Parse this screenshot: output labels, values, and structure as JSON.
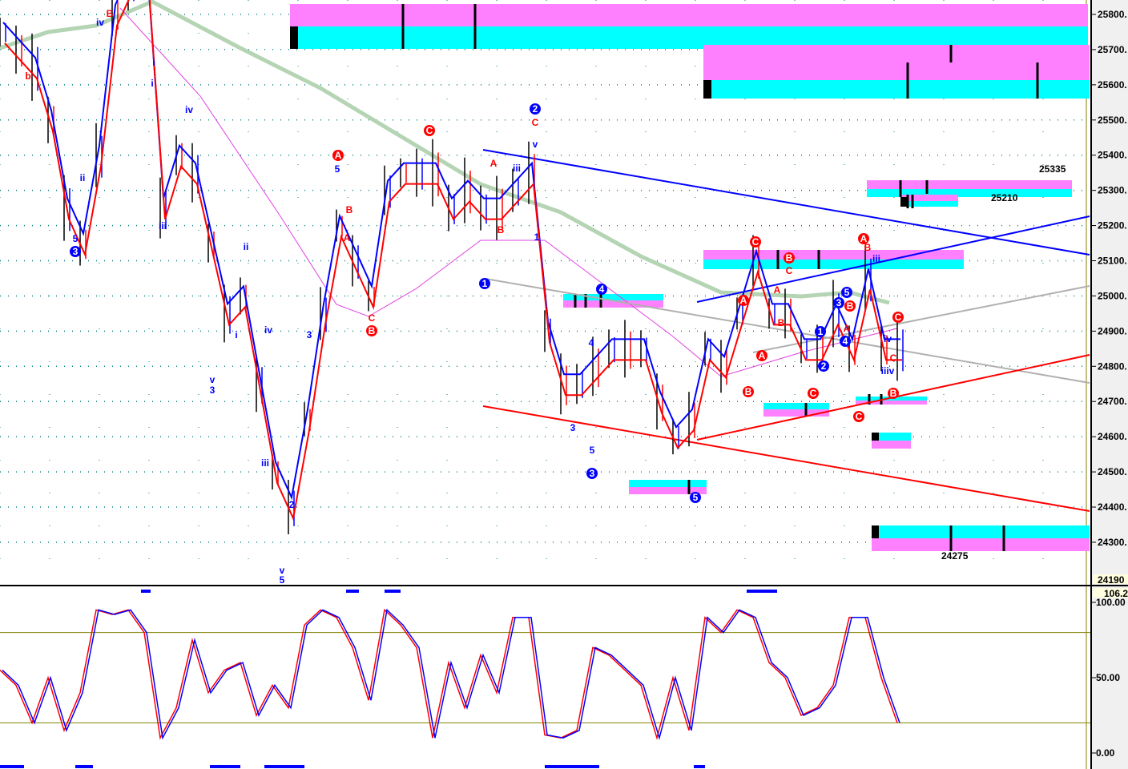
{
  "chart_data": {
    "type": "line",
    "title": "",
    "price_axis": {
      "ticks": [
        25800,
        25700,
        25600,
        25500,
        25400,
        25300,
        25200,
        25100,
        25000,
        24900,
        24800,
        24700,
        24600,
        24500,
        24400,
        24300
      ],
      "ylim": [
        24190,
        25850
      ],
      "current_label": "24190"
    },
    "oscillator_axis": {
      "ticks": [
        "100.00",
        "50.00",
        "0.00"
      ],
      "ylim": [
        0,
        106.2
      ],
      "top_label": "106.2",
      "levels": [
        80,
        20
      ]
    },
    "price_series": {
      "name": "price",
      "values": [
        25750,
        25700,
        25650,
        25500,
        25250,
        25150,
        25400,
        25800,
        25900,
        25900,
        25250,
        25400,
        25350,
        25150,
        24950,
        25000,
        24750,
        24500,
        24400,
        24650,
        24950,
        25200,
        25100,
        25000,
        25300,
        25350,
        25350,
        25350,
        25250,
        25300,
        25250,
        25250,
        25300,
        25350,
        24900,
        24750,
        24750,
        24800,
        24850,
        24850,
        24850,
        24700,
        24600,
        24650,
        24850,
        24800,
        24950,
        25100,
        24950,
        24950,
        24850,
        24850,
        24950,
        24850,
        25050,
        24850,
        24850
      ]
    },
    "oscillator_series": {
      "name": "stochastic",
      "values": [
        55,
        45,
        20,
        50,
        15,
        40,
        95,
        92,
        95,
        80,
        10,
        30,
        75,
        40,
        55,
        60,
        25,
        45,
        30,
        85,
        95,
        90,
        70,
        35,
        95,
        85,
        70,
        10,
        60,
        30,
        65,
        40,
        90,
        90,
        12,
        10,
        15,
        70,
        65,
        55,
        45,
        10,
        50,
        15,
        90,
        80,
        95,
        90,
        60,
        50,
        25,
        30,
        45,
        90,
        90,
        50,
        20
      ]
    },
    "price_labels": [
      "25335",
      "25210",
      "24275"
    ],
    "annotations": [
      "b",
      "B",
      "iv",
      "5",
      "3",
      "ii",
      "i",
      "i",
      "iii",
      "iv",
      "ii",
      "i",
      "v",
      "3",
      "iv",
      "3",
      "iii",
      "2",
      "v",
      "5",
      "A",
      "5",
      "B",
      "A",
      "C",
      "B",
      "C",
      "2",
      "C",
      "v",
      "A",
      "iii",
      "B",
      "1",
      "1",
      "4",
      "4",
      "3",
      "5",
      "3",
      "5",
      "C",
      "B",
      "C",
      "A",
      "A",
      "B",
      "A",
      "B",
      "C",
      "1",
      "2",
      "3",
      "5",
      "4",
      "B",
      "A",
      "A",
      "B",
      "iii",
      "C",
      "iv",
      "C",
      "iiiv",
      "B",
      "C"
    ],
    "colors": {
      "pink": "#ff80ff",
      "cyan": "#00ffff",
      "blue": "#0000ff",
      "red": "#ff0000",
      "ma_green": "#b4d4b4",
      "ma_magenta": "#e040e0",
      "grid": "#008080",
      "olive": "#808000"
    }
  }
}
